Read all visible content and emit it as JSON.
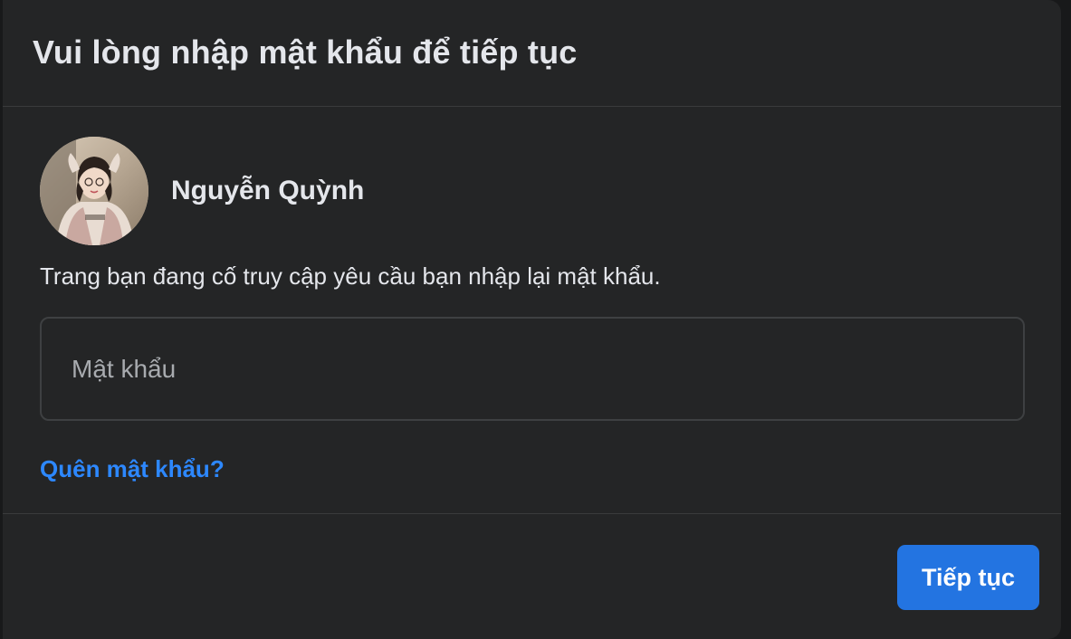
{
  "dialog": {
    "title": "Vui lòng nhập mật khẩu để tiếp tục"
  },
  "profile": {
    "name": "Nguyễn Quỳnh",
    "avatar_icon": "profile-photo"
  },
  "description": "Trang bạn đang cố truy cập yêu cầu bạn nhập lại mật khẩu.",
  "password": {
    "placeholder": "Mật khẩu",
    "value": ""
  },
  "forgot_password_label": "Quên mật khẩu?",
  "continue_label": "Tiếp tục",
  "colors": {
    "background": "#242526",
    "text": "#e4e6eb",
    "link": "#2d88ff",
    "primary_button": "#2374e1",
    "divider": "#3a3b3c"
  }
}
